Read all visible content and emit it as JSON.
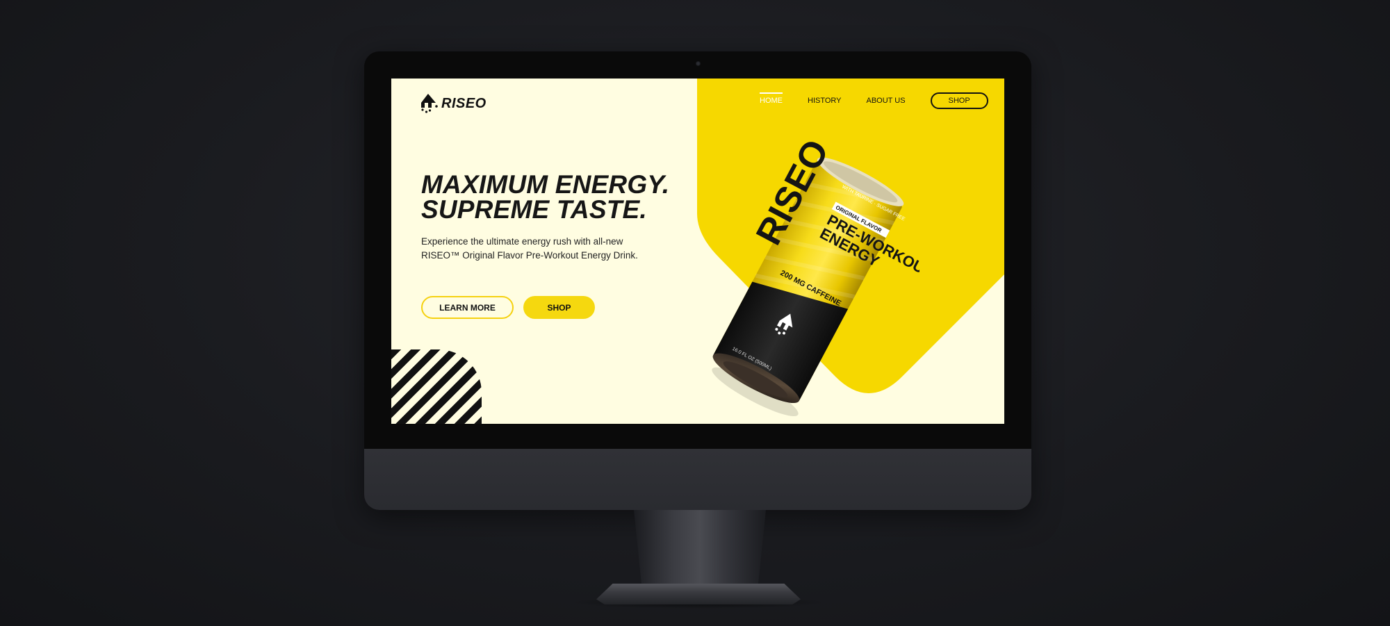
{
  "colors": {
    "accent_yellow": "#f6d800",
    "background_cream": "#fffde1",
    "text_dark": "#161616"
  },
  "brand": {
    "name": "RISEO",
    "logo_icon": "arrow-drip-icon"
  },
  "nav": {
    "items": [
      {
        "label": "HOME",
        "active": true
      },
      {
        "label": "HISTORY",
        "active": false
      },
      {
        "label": "ABOUT US",
        "active": false
      }
    ],
    "shop_label": "SHOP"
  },
  "hero": {
    "headline_line1": "MAXIMUM ENERGY.",
    "headline_line2": "SUPREME TASTE.",
    "subtext": "Experience the ultimate energy rush with all-new RISEO™ Original Flavor Pre-Workout Energy Drink.",
    "learn_more_label": "LEARN MORE",
    "shop_label": "SHOP"
  },
  "product_can": {
    "top_band": "WITH TAURINE · SUGAR FREE",
    "flavor_badge": "ORIGINAL FLAVOR",
    "line1": "PRE-WORKOUT",
    "line2": "ENERGY",
    "caffeine": "200 MG CAFFEINE",
    "size": "16.0 FL OZ (500ML)",
    "brand_vertical": "RISEO"
  }
}
